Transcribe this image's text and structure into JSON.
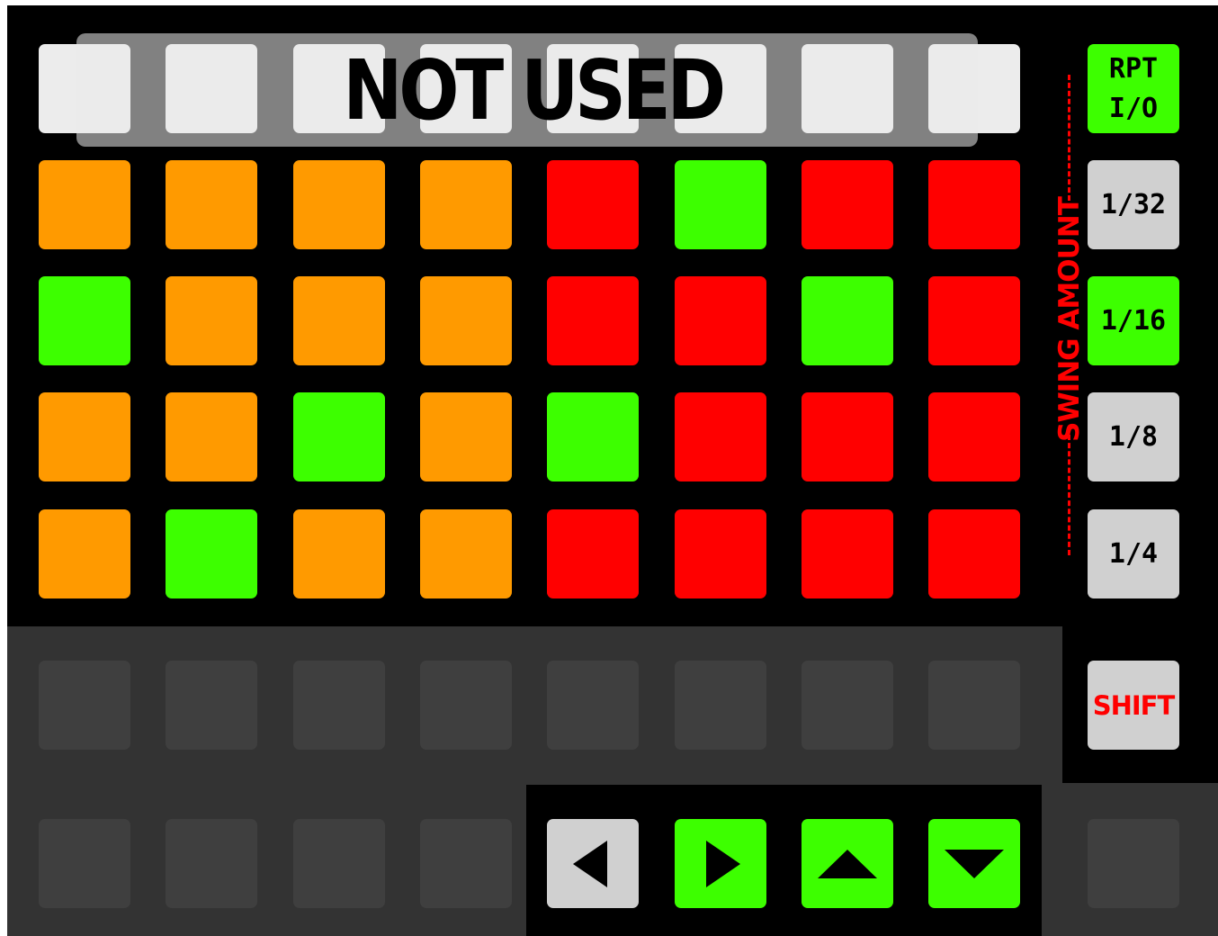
{
  "colors": {
    "orange": "#ff9a00",
    "red": "#ff0000",
    "green": "#3dff00",
    "light_grey": "#d0d0d0",
    "dark_pad": "#3f3f3f",
    "off_pad": "#ececec"
  },
  "top_row": {
    "overlay_text": "NOT USED",
    "pad_count": 8
  },
  "grid": {
    "rows": [
      [
        "orange",
        "orange",
        "orange",
        "orange",
        "red",
        "green",
        "red",
        "red"
      ],
      [
        "green",
        "orange",
        "orange",
        "orange",
        "red",
        "red",
        "green",
        "red"
      ],
      [
        "orange",
        "orange",
        "green",
        "orange",
        "green",
        "red",
        "red",
        "red"
      ],
      [
        "orange",
        "green",
        "orange",
        "orange",
        "red",
        "red",
        "red",
        "red"
      ]
    ]
  },
  "side_buttons": [
    {
      "label": "RPT\nI/O",
      "color": "green"
    },
    {
      "label": "1/32",
      "color": "light_grey"
    },
    {
      "label": "1/16",
      "color": "green"
    },
    {
      "label": "1/8",
      "color": "light_grey"
    },
    {
      "label": "1/4",
      "color": "light_grey"
    }
  ],
  "swing_label": "SWING AMOUNT",
  "shift_button": {
    "label": "SHIFT",
    "color": "light_grey",
    "text_color": "#ff0000"
  },
  "inactive_rows": {
    "row1_count": 8,
    "row2_count": 4,
    "extra_right_pad": true
  },
  "nav_buttons": [
    {
      "icon": "arrow-left-icon",
      "color": "light_grey"
    },
    {
      "icon": "arrow-right-icon",
      "color": "green"
    },
    {
      "icon": "arrow-up-icon",
      "color": "green"
    },
    {
      "icon": "arrow-down-icon",
      "color": "green"
    }
  ]
}
